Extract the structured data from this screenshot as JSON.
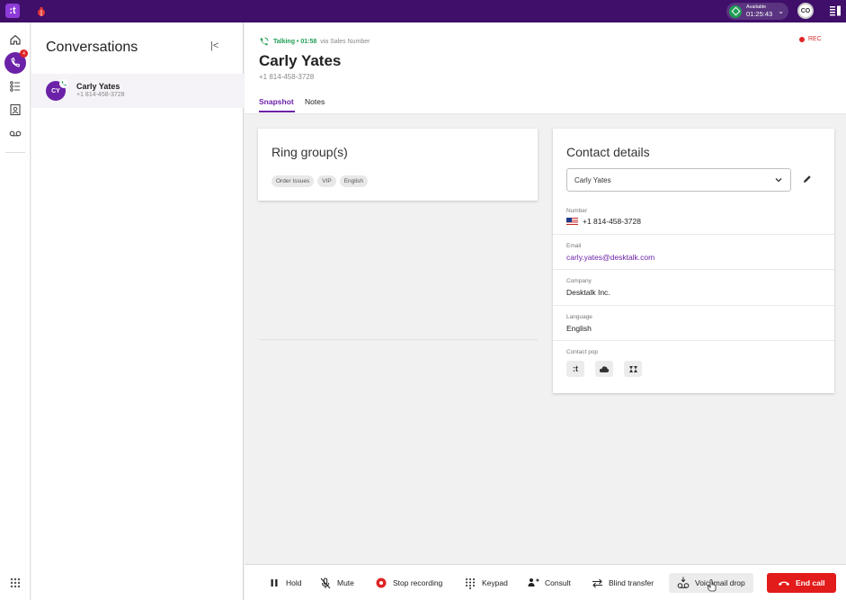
{
  "topbar": {
    "logo_text": ":t",
    "status": {
      "label": "Available",
      "timer": "01:25:43"
    },
    "avatar_initials": "CO",
    "colors": {
      "bar": "#3f0f6a",
      "status": "#1f9d55"
    }
  },
  "rail": {
    "items": [
      "home-icon",
      "conversations-icon",
      "queue-icon",
      "contacts-icon",
      "voicemail-icon"
    ],
    "badge": "4"
  },
  "conversations": {
    "title": "Conversations",
    "collapse_label": "|<",
    "items": [
      {
        "initials": "CY",
        "name": "Carly Yates",
        "number": "+1 814-458-3728"
      }
    ]
  },
  "call": {
    "status": "Talking • 01:58",
    "via": "via Sales Number",
    "rec_label": "REC",
    "caller_name": "Carly Yates",
    "caller_number": "+1 814-458-3728"
  },
  "tabs": [
    {
      "label": "Snapshot",
      "active": true
    },
    {
      "label": "Notes",
      "active": false
    }
  ],
  "ring_group": {
    "title": "Ring group(s)",
    "tags": [
      "Order Issues",
      "VIP",
      "English"
    ]
  },
  "contact": {
    "title": "Contact details",
    "selected": "Carly Yates",
    "fields": [
      {
        "label": "Number",
        "value": "+1 814-458-3728"
      },
      {
        "label": "Email",
        "value": "carly.yates@desktalk.com"
      },
      {
        "label": "Company",
        "value": "Desktalk Inc."
      },
      {
        "label": "Language",
        "value": "English"
      }
    ],
    "pop_label": "Contact pop",
    "pop_icons": [
      ":t",
      "cloud-icon",
      "zendesk-icon"
    ]
  },
  "callbar": {
    "hold": "Hold",
    "mute": "Mute",
    "stop_recording": "Stop recording",
    "keypad": "Keypad",
    "consult": "Consult",
    "blind_transfer": "Blind transfer",
    "voicemail_drop": "Voicemail drop",
    "end_call": "End call",
    "colors": {
      "end_call": "#e21b1b",
      "accent": "#6b21a8"
    }
  }
}
